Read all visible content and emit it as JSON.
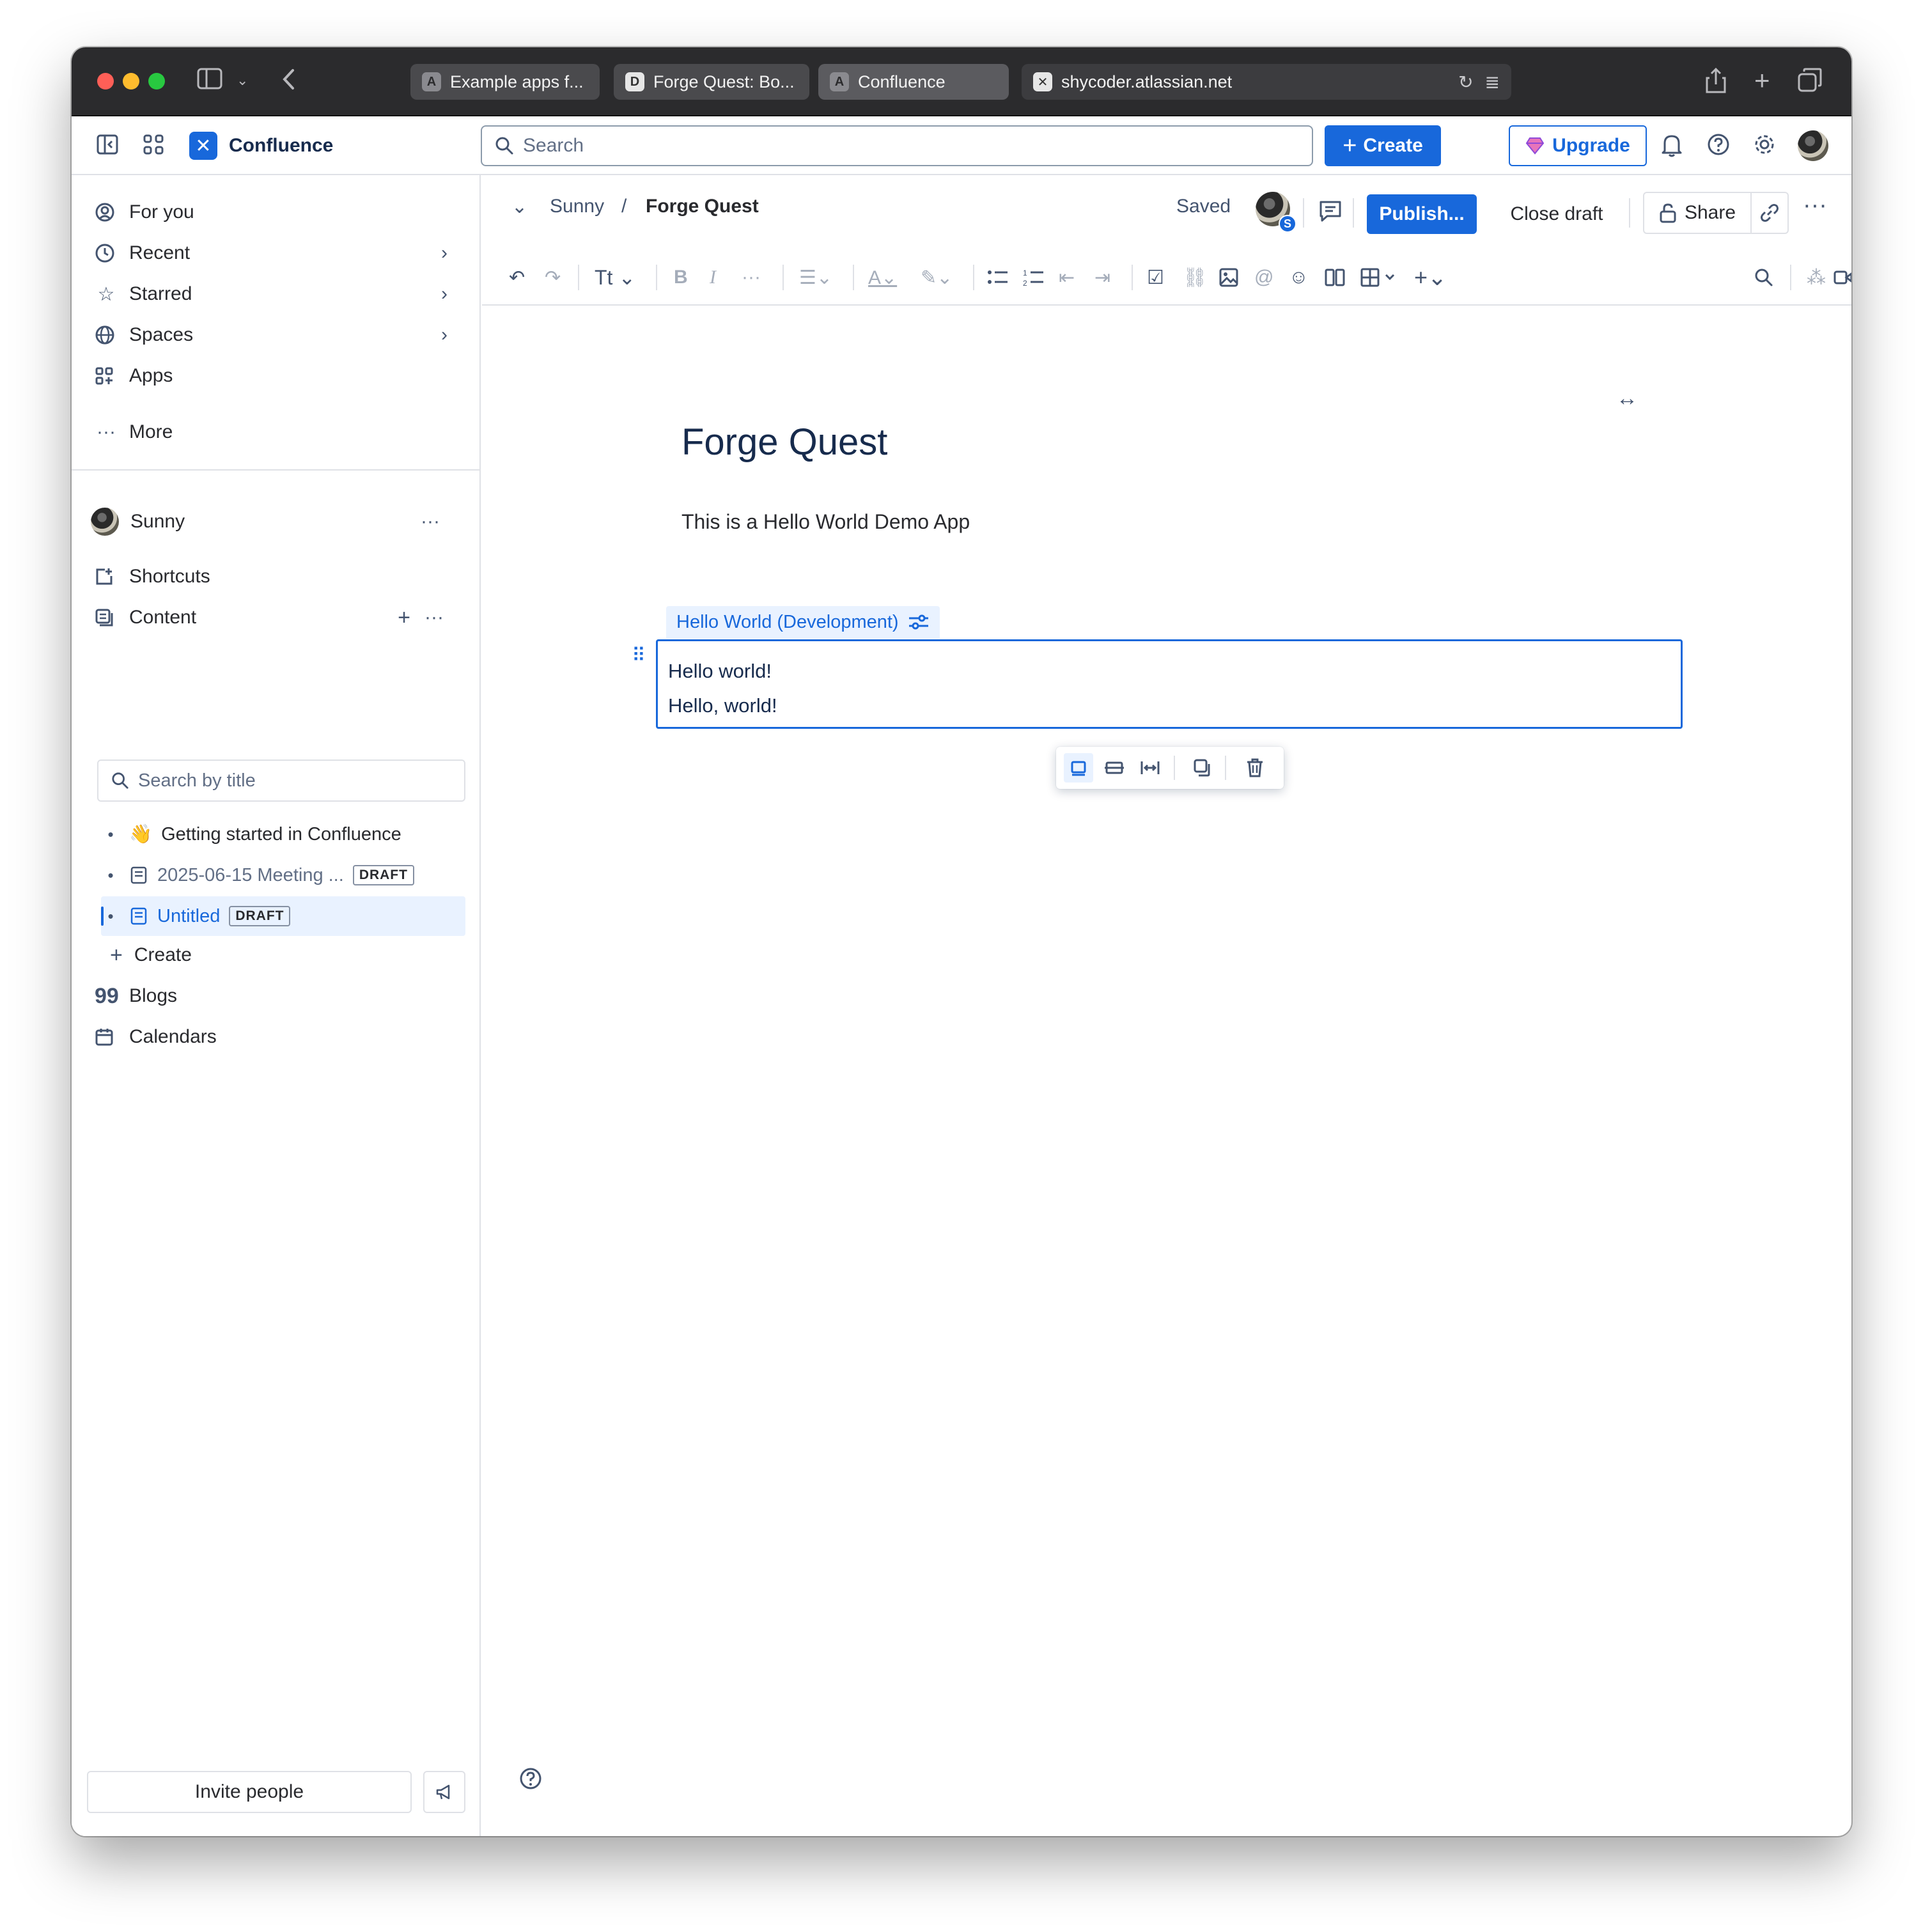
{
  "browser": {
    "tabs": [
      {
        "favicon": "A",
        "label": "Example apps f..."
      },
      {
        "favicon": "D",
        "label": "Forge Quest: Bo..."
      },
      {
        "favicon": "A",
        "label": "Confluence"
      }
    ],
    "url": "shycoder.atlassian.net"
  },
  "topnav": {
    "brand": "Confluence",
    "search_placeholder": "Search",
    "create_label": "Create",
    "upgrade_label": "Upgrade"
  },
  "sidebar": {
    "nav": [
      {
        "label": "For you",
        "icon": "user-circle-icon"
      },
      {
        "label": "Recent",
        "icon": "clock-icon"
      },
      {
        "label": "Starred",
        "icon": "star-icon"
      },
      {
        "label": "Spaces",
        "icon": "globe-icon"
      },
      {
        "label": "Apps",
        "icon": "apps-icon"
      },
      {
        "label": "More",
        "icon": "more-icon"
      }
    ],
    "space_name": "Sunny",
    "shortcuts_label": "Shortcuts",
    "content_label": "Content",
    "search_placeholder": "Search by title",
    "tree": [
      {
        "emoji": "👋",
        "label": "Getting started in Confluence",
        "badge": ""
      },
      {
        "emoji": "",
        "label": "2025-06-15 Meeting ...",
        "badge": "DRAFT"
      },
      {
        "emoji": "",
        "label": "Untitled",
        "badge": "DRAFT"
      }
    ],
    "create_label": "Create",
    "blogs_label": "Blogs",
    "calendars_label": "Calendars",
    "invite_label": "Invite people"
  },
  "header": {
    "breadcrumb_space": "Sunny",
    "breadcrumb_separator": "/",
    "breadcrumb_page": "Forge Quest",
    "saved_label": "Saved",
    "avatar_badge": "S",
    "publish_label": "Publish...",
    "close_draft_label": "Close draft",
    "share_label": "Share"
  },
  "document": {
    "title": "Forge Quest",
    "paragraph": "This is a Hello World Demo App",
    "macro_label": "Hello World (Development)",
    "macro_lines": [
      "Hello world!",
      "Hello, world!"
    ]
  },
  "colors": {
    "brand_blue": "#1868db",
    "selection_bg": "#e9f2ff",
    "chrome_bg": "#2b2b2d"
  }
}
